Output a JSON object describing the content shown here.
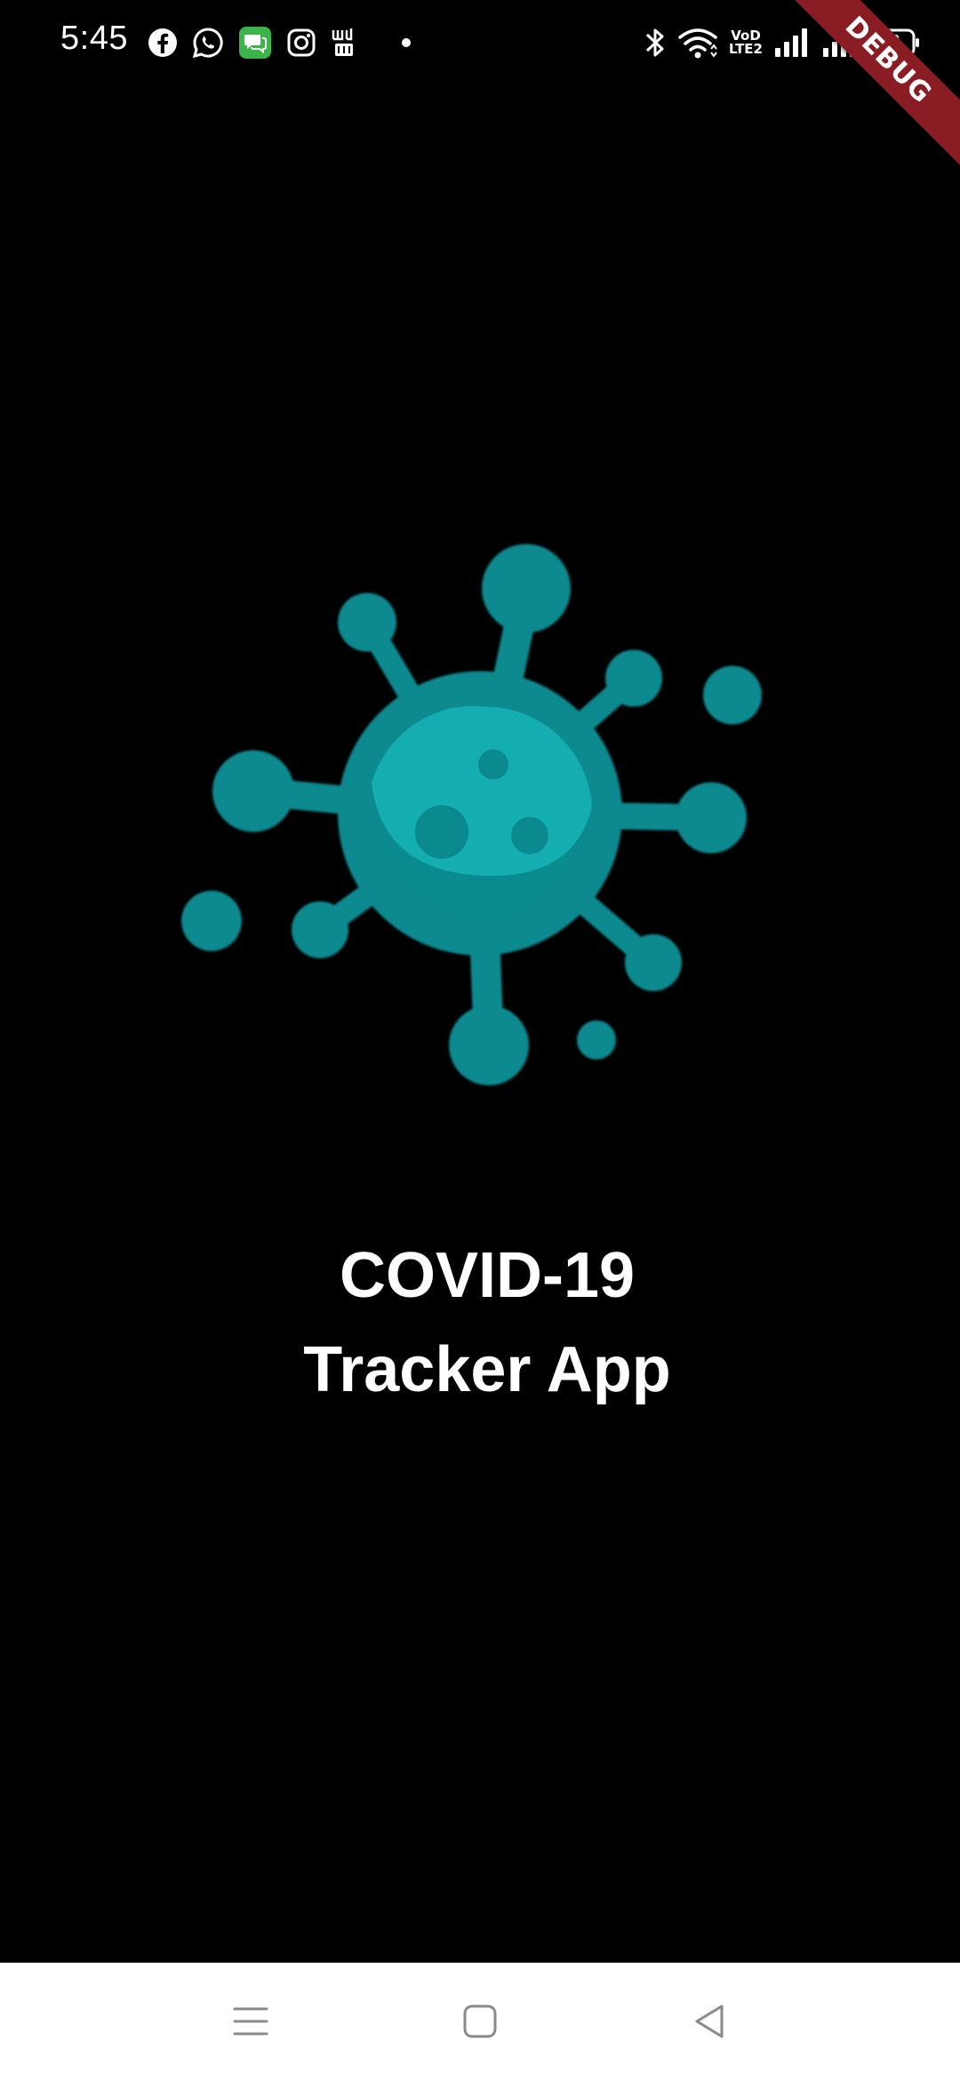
{
  "status_bar": {
    "time": "5:45",
    "left_icons": [
      "facebook-icon",
      "whatsapp-icon",
      "messages-icon",
      "instagram-icon",
      "arabic-calendar-icon",
      "notification-dot"
    ],
    "right_icons": [
      "bluetooth-icon",
      "wifi-icon",
      "volte-icon",
      "signal-icon",
      "signal-icon",
      "battery-icon"
    ],
    "volte_line1": "VoD",
    "volte_line2": "LTE2"
  },
  "debug_banner": "DEBUG",
  "splash": {
    "logo": "virus-icon",
    "title_line1": "COVID-19",
    "title_line2": "Tracker App"
  },
  "colors": {
    "background": "#000000",
    "virus_primary": "#0a8a8f",
    "virus_highlight": "#14adb0",
    "debug_ribbon": "#8a1c24",
    "nav_bar": "#ffffff"
  },
  "nav_bar": {
    "buttons": [
      "menu-icon",
      "home-icon",
      "back-icon"
    ]
  }
}
